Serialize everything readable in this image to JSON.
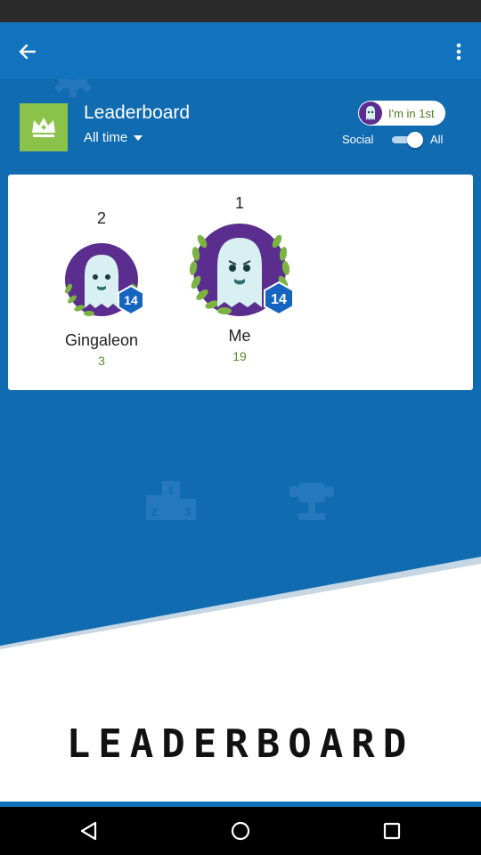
{
  "colors": {
    "app_blue": "#106bb0",
    "toolbar_blue": "#1173bd",
    "game_icon_green": "#8bc34a",
    "score_green": "#558b2f",
    "avatar_purple": "#5b2d8e",
    "badge_blue": "#1565c0"
  },
  "toolbar": {
    "back_icon": "arrow-back-icon",
    "more_icon": "more-vertical-icon"
  },
  "leaderboard": {
    "title": "Leaderboard",
    "time_filter": "All time",
    "rank_chip": "I'm in 1st",
    "toggle_left_label": "Social",
    "toggle_right_label": "All",
    "toggle_state": "All"
  },
  "players": [
    {
      "rank": "2",
      "name": "Gingaleon",
      "score": "3",
      "level": "14"
    },
    {
      "rank": "1",
      "name": "Me",
      "score": "19",
      "level": "14"
    }
  ],
  "banner": {
    "text": "LEADERBOARD"
  },
  "nav": {
    "back_icon": "nav-back-icon",
    "home_icon": "nav-home-icon",
    "recents_icon": "nav-recents-icon"
  }
}
